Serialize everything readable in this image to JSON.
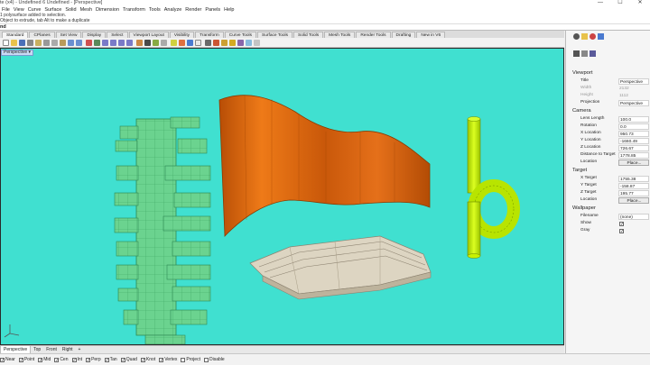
{
  "window": {
    "title": "d - Untitled - Rhino 6 - [Perspective]",
    "title_visible": "te (x4) - Undefined 6 Undefined - [Perspective]",
    "controls": [
      "—",
      "☐",
      "✕"
    ]
  },
  "menu": [
    "File",
    "View",
    "Curve",
    "Surface",
    "Solid",
    "Mesh",
    "Dimension",
    "Transform",
    "Tools",
    "Analyze",
    "Render",
    "Panels",
    "Help"
  ],
  "command_history": [
    "1 polysurface added to selection.",
    "Object to extrude, tab Alt to make a duplicate"
  ],
  "command_prompt": "nd",
  "toolbar_tabs": [
    "Standard",
    "CPlanes",
    "Set View",
    "Display",
    "Select",
    "Viewport Layout",
    "Visibility",
    "Transform",
    "Curve Tools",
    "Surface Tools",
    "Solid Tools",
    "Mesh Tools",
    "Render Tools",
    "Drafting",
    "New in V6"
  ],
  "viewport": {
    "label": "Perspective",
    "background": "#40e0d0"
  },
  "viewport_tabs": [
    "Perspective",
    "Top",
    "Front",
    "Right"
  ],
  "viewport_tabs_add": "+",
  "osnaps": [
    {
      "label": "Near",
      "checked": true
    },
    {
      "label": "Point",
      "checked": true
    },
    {
      "label": "Mid",
      "checked": true
    },
    {
      "label": "Cen",
      "checked": true
    },
    {
      "label": "Int",
      "checked": true
    },
    {
      "label": "Perp",
      "checked": true
    },
    {
      "label": "Tan",
      "checked": true
    },
    {
      "label": "Quad",
      "checked": true
    },
    {
      "label": "Knot",
      "checked": true
    },
    {
      "label": "Vertex",
      "checked": true
    },
    {
      "label": "Project",
      "checked": false
    },
    {
      "label": "Disable",
      "checked": false
    }
  ],
  "properties": {
    "viewport_section": "Viewport",
    "title_label": "Title",
    "title_value": "Perspective",
    "width_label": "Width",
    "width_value": "2132",
    "height_label": "Height",
    "height_value": "1112",
    "projection_label": "Projection",
    "projection_value": "Perspective",
    "camera_section": "Camera",
    "lens_label": "Lens Length",
    "lens_value": "100.0",
    "rotation_label": "Rotation",
    "rotation_value": "0.0",
    "xloc_label": "X Location",
    "xloc_value": "950.73",
    "yloc_label": "Y Location",
    "yloc_value": "-1660.49",
    "zloc_label": "Z Location",
    "zloc_value": "726.67",
    "dist_label": "Distance to Target",
    "dist_value": "1778.85",
    "location_label": "Location",
    "place_button": "Place...",
    "target_section": "Target",
    "xt_label": "X Target",
    "xt_value": "1755.38",
    "yt_label": "Y Target",
    "yt_value": "-158.87",
    "zt_label": "Z Target",
    "zt_value": "195.77",
    "tloc_label": "Location",
    "tplace_button": "Place...",
    "wallpaper_section": "Wallpaper",
    "filename_label": "Filename",
    "filename_value": "(none)",
    "show_label": "Show",
    "show_checked": true,
    "gray_label": "Gray",
    "gray_checked": true
  },
  "colors": {
    "green_object": "#6bd38f",
    "orange_object": "#e06b10",
    "yellow_object": "#c8f000",
    "beige_object": "#ddd5c2"
  }
}
